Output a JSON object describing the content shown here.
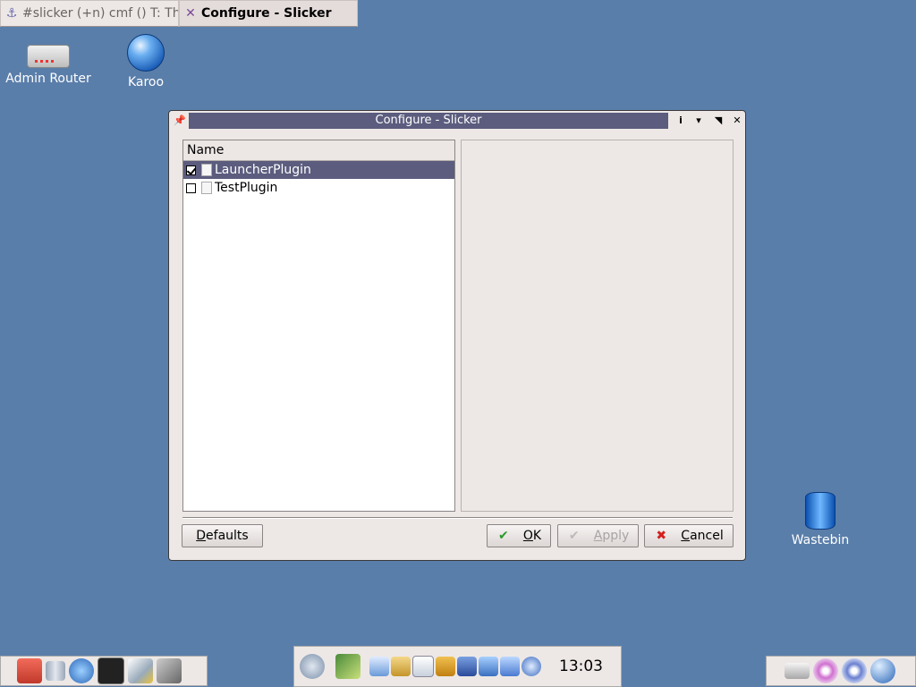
{
  "taskbar": {
    "tasks": [
      {
        "label": "#slicker (+n) cmf () T: The"
      },
      {
        "label": "Configure - Slicker"
      }
    ]
  },
  "desktop": {
    "icons": [
      {
        "label": "Admin Router",
        "icon": "router-icon"
      },
      {
        "label": "Karoo",
        "icon": "globe-icon"
      },
      {
        "label": "Wastebin",
        "icon": "trash-icon"
      }
    ]
  },
  "dialog": {
    "title": "Configure - Slicker",
    "list": {
      "header": "Name",
      "items": [
        {
          "label": "LauncherPlugin",
          "checked": true,
          "selected": true
        },
        {
          "label": "TestPlugin",
          "checked": false,
          "selected": false
        }
      ]
    },
    "buttons": {
      "defaults": "Defaults",
      "ok": "OK",
      "apply": "Apply",
      "cancel": "Cancel"
    }
  },
  "panel": {
    "clock": "13:03"
  },
  "colors": {
    "desktop": "#5a7eaa",
    "titlebar": "#5b5c7e",
    "dialog_bg": "#ede8e6"
  }
}
